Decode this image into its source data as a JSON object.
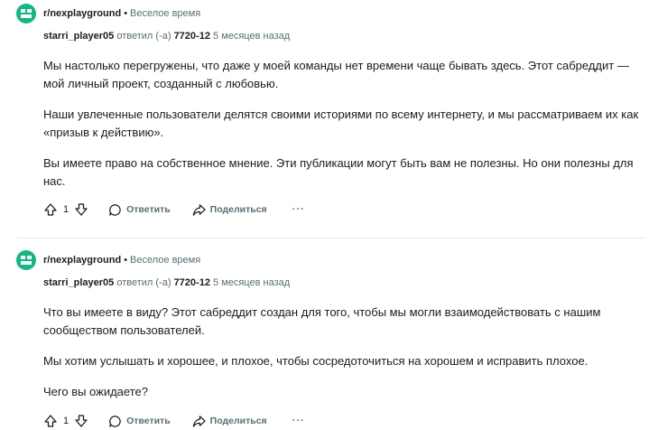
{
  "comments": [
    {
      "subreddit": "r/nexplayground",
      "separator": "•",
      "post_title": "Веселое время",
      "author": "starri_player05",
      "replied_label": "ответил (-а)",
      "reply_to": "7720-12",
      "time_ago": "5 месяцев назад",
      "paragraphs": [
        "Мы настолько перегружены, что даже у моей команды нет времени чаще бывать здесь. Этот сабреддит — мой личный проект, созданный с любовью.",
        "Наши увлеченные пользователи делятся своими историями по всему интернету, и мы рассматриваем их как «призыв к действию».",
        "Вы имеете право на собственное мнение. Эти публикации могут быть вам не полезны. Но они полезны для нас."
      ],
      "votes": "1",
      "reply_label": "Ответить",
      "share_label": "Поделиться",
      "more_label": "···"
    },
    {
      "subreddit": "r/nexplayground",
      "separator": "•",
      "post_title": "Веселое время",
      "author": "starri_player05",
      "replied_label": "ответил (-а)",
      "reply_to": "7720-12",
      "time_ago": "5 месяцев назад",
      "paragraphs": [
        "Что вы имеете в виду? Этот сабреддит создан для того, чтобы мы могли взаимодействовать с нашим сообществом пользователей.",
        "Мы хотим услышать и хорошее, и плохое, чтобы сосредоточиться на хорошем и исправить плохое.",
        "Чего вы ожидаете?"
      ],
      "votes": "1",
      "reply_label": "Ответить",
      "share_label": "Поделиться",
      "more_label": "···"
    }
  ],
  "colors": {
    "avatar": "#10b981",
    "muted": "#576f76",
    "text": "#1c1c1c"
  }
}
